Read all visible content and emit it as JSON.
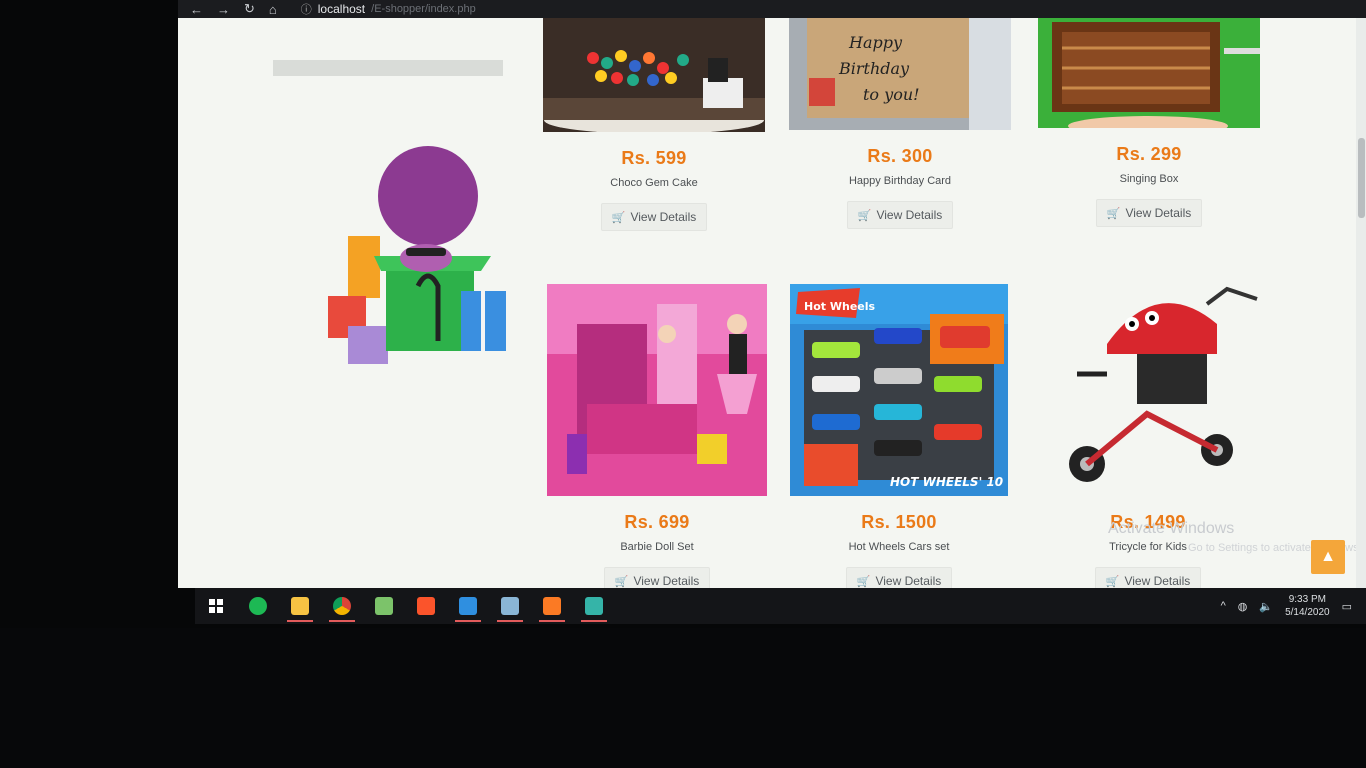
{
  "browser": {
    "url": "localhost",
    "url_rest": "/E-shopper/index.php"
  },
  "products": [
    {
      "price": "Rs. 599",
      "name": "Choco Gem Cake",
      "button": "View Details"
    },
    {
      "price": "Rs. 300",
      "name": "Happy Birthday Card",
      "button": "View Details"
    },
    {
      "price": "Rs. 299",
      "name": "Singing Box",
      "button": "View Details"
    },
    {
      "price": "Rs. 699",
      "name": "Barbie Doll Set",
      "button": "View Details"
    },
    {
      "price": "Rs. 1500",
      "name": "Hot Wheels Cars set",
      "button": "View Details"
    },
    {
      "price": "Rs. 1499",
      "name": "Tricycle for Kids",
      "button": "View Details"
    }
  ],
  "images": {
    "card": {
      "line1": "Happy",
      "line2": "Birthday",
      "line3": "to you!"
    },
    "hot_wheels_logo": "Hot Wheels",
    "hot_wheels_label": "HOT WHEELS' 10"
  },
  "watermark": {
    "title": "Activate Windows",
    "subtitle": "Go to Settings to activate Windows."
  },
  "taskbar": {
    "time": "9:33 PM",
    "date": "5/14/2020"
  },
  "colors": {
    "price": "#ea7a18",
    "scroll_top_button": "#f4a63a"
  }
}
